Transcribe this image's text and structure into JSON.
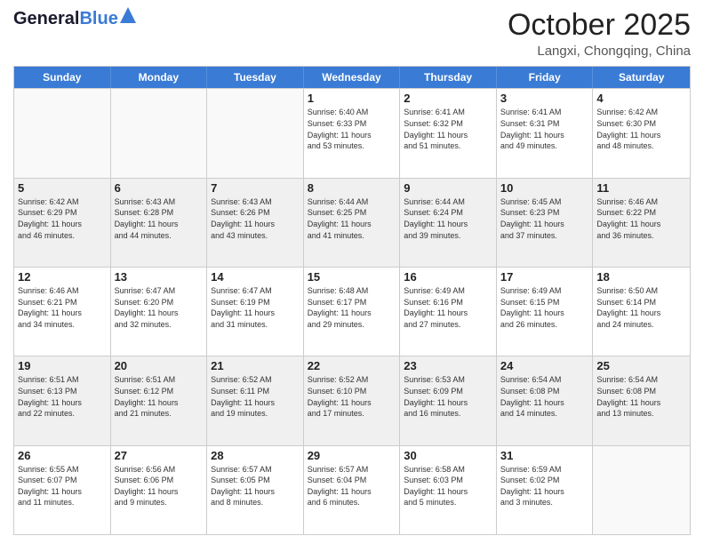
{
  "header": {
    "logo_general": "General",
    "logo_blue": "Blue",
    "month_title": "October 2025",
    "location": "Langxi, Chongqing, China"
  },
  "calendar": {
    "weekdays": [
      "Sunday",
      "Monday",
      "Tuesday",
      "Wednesday",
      "Thursday",
      "Friday",
      "Saturday"
    ],
    "rows": [
      [
        {
          "day": "",
          "info": ""
        },
        {
          "day": "",
          "info": ""
        },
        {
          "day": "",
          "info": ""
        },
        {
          "day": "1",
          "info": "Sunrise: 6:40 AM\nSunset: 6:33 PM\nDaylight: 11 hours\nand 53 minutes."
        },
        {
          "day": "2",
          "info": "Sunrise: 6:41 AM\nSunset: 6:32 PM\nDaylight: 11 hours\nand 51 minutes."
        },
        {
          "day": "3",
          "info": "Sunrise: 6:41 AM\nSunset: 6:31 PM\nDaylight: 11 hours\nand 49 minutes."
        },
        {
          "day": "4",
          "info": "Sunrise: 6:42 AM\nSunset: 6:30 PM\nDaylight: 11 hours\nand 48 minutes."
        }
      ],
      [
        {
          "day": "5",
          "info": "Sunrise: 6:42 AM\nSunset: 6:29 PM\nDaylight: 11 hours\nand 46 minutes."
        },
        {
          "day": "6",
          "info": "Sunrise: 6:43 AM\nSunset: 6:28 PM\nDaylight: 11 hours\nand 44 minutes."
        },
        {
          "day": "7",
          "info": "Sunrise: 6:43 AM\nSunset: 6:26 PM\nDaylight: 11 hours\nand 43 minutes."
        },
        {
          "day": "8",
          "info": "Sunrise: 6:44 AM\nSunset: 6:25 PM\nDaylight: 11 hours\nand 41 minutes."
        },
        {
          "day": "9",
          "info": "Sunrise: 6:44 AM\nSunset: 6:24 PM\nDaylight: 11 hours\nand 39 minutes."
        },
        {
          "day": "10",
          "info": "Sunrise: 6:45 AM\nSunset: 6:23 PM\nDaylight: 11 hours\nand 37 minutes."
        },
        {
          "day": "11",
          "info": "Sunrise: 6:46 AM\nSunset: 6:22 PM\nDaylight: 11 hours\nand 36 minutes."
        }
      ],
      [
        {
          "day": "12",
          "info": "Sunrise: 6:46 AM\nSunset: 6:21 PM\nDaylight: 11 hours\nand 34 minutes."
        },
        {
          "day": "13",
          "info": "Sunrise: 6:47 AM\nSunset: 6:20 PM\nDaylight: 11 hours\nand 32 minutes."
        },
        {
          "day": "14",
          "info": "Sunrise: 6:47 AM\nSunset: 6:19 PM\nDaylight: 11 hours\nand 31 minutes."
        },
        {
          "day": "15",
          "info": "Sunrise: 6:48 AM\nSunset: 6:17 PM\nDaylight: 11 hours\nand 29 minutes."
        },
        {
          "day": "16",
          "info": "Sunrise: 6:49 AM\nSunset: 6:16 PM\nDaylight: 11 hours\nand 27 minutes."
        },
        {
          "day": "17",
          "info": "Sunrise: 6:49 AM\nSunset: 6:15 PM\nDaylight: 11 hours\nand 26 minutes."
        },
        {
          "day": "18",
          "info": "Sunrise: 6:50 AM\nSunset: 6:14 PM\nDaylight: 11 hours\nand 24 minutes."
        }
      ],
      [
        {
          "day": "19",
          "info": "Sunrise: 6:51 AM\nSunset: 6:13 PM\nDaylight: 11 hours\nand 22 minutes."
        },
        {
          "day": "20",
          "info": "Sunrise: 6:51 AM\nSunset: 6:12 PM\nDaylight: 11 hours\nand 21 minutes."
        },
        {
          "day": "21",
          "info": "Sunrise: 6:52 AM\nSunset: 6:11 PM\nDaylight: 11 hours\nand 19 minutes."
        },
        {
          "day": "22",
          "info": "Sunrise: 6:52 AM\nSunset: 6:10 PM\nDaylight: 11 hours\nand 17 minutes."
        },
        {
          "day": "23",
          "info": "Sunrise: 6:53 AM\nSunset: 6:09 PM\nDaylight: 11 hours\nand 16 minutes."
        },
        {
          "day": "24",
          "info": "Sunrise: 6:54 AM\nSunset: 6:08 PM\nDaylight: 11 hours\nand 14 minutes."
        },
        {
          "day": "25",
          "info": "Sunrise: 6:54 AM\nSunset: 6:08 PM\nDaylight: 11 hours\nand 13 minutes."
        }
      ],
      [
        {
          "day": "26",
          "info": "Sunrise: 6:55 AM\nSunset: 6:07 PM\nDaylight: 11 hours\nand 11 minutes."
        },
        {
          "day": "27",
          "info": "Sunrise: 6:56 AM\nSunset: 6:06 PM\nDaylight: 11 hours\nand 9 minutes."
        },
        {
          "day": "28",
          "info": "Sunrise: 6:57 AM\nSunset: 6:05 PM\nDaylight: 11 hours\nand 8 minutes."
        },
        {
          "day": "29",
          "info": "Sunrise: 6:57 AM\nSunset: 6:04 PM\nDaylight: 11 hours\nand 6 minutes."
        },
        {
          "day": "30",
          "info": "Sunrise: 6:58 AM\nSunset: 6:03 PM\nDaylight: 11 hours\nand 5 minutes."
        },
        {
          "day": "31",
          "info": "Sunrise: 6:59 AM\nSunset: 6:02 PM\nDaylight: 11 hours\nand 3 minutes."
        },
        {
          "day": "",
          "info": ""
        }
      ]
    ]
  }
}
